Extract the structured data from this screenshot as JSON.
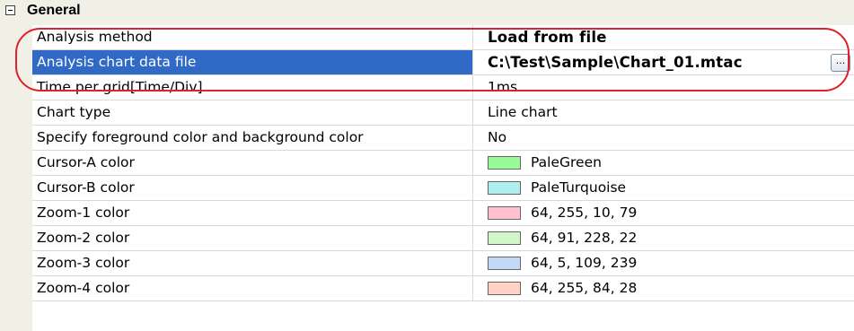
{
  "category": {
    "label": "General"
  },
  "rows": [
    {
      "name": "Analysis method",
      "value": "Load from file"
    },
    {
      "name": "Analysis chart data file",
      "value": "C:\\Test\\Sample\\Chart_01.mtac",
      "browse_label": "..."
    },
    {
      "name": "Time per grid[Time/Div]",
      "value": "1ms"
    },
    {
      "name": "Chart type",
      "value": "Line chart"
    },
    {
      "name": "Specify foreground color and background color",
      "value": "No"
    },
    {
      "name": "Cursor-A color",
      "value": "PaleGreen",
      "color": "#98fb98"
    },
    {
      "name": "Cursor-B color",
      "value": "PaleTurquoise",
      "color": "#afeeee"
    },
    {
      "name": "Zoom-1 color",
      "value": "64, 255, 10, 79",
      "color": "#ffc0cf"
    },
    {
      "name": "Zoom-2 color",
      "value": "64, 91, 228, 22",
      "color": "#d2f7c7"
    },
    {
      "name": "Zoom-3 color",
      "value": "64, 5, 109, 239",
      "color": "#c2d9f8"
    },
    {
      "name": "Zoom-4 color",
      "value": "64, 255, 84, 28",
      "color": "#ffd2c6"
    }
  ],
  "colors": {
    "selection": "#3169c6",
    "highlight_outline": "#e0202a",
    "gutter": "#f1f0e6"
  }
}
